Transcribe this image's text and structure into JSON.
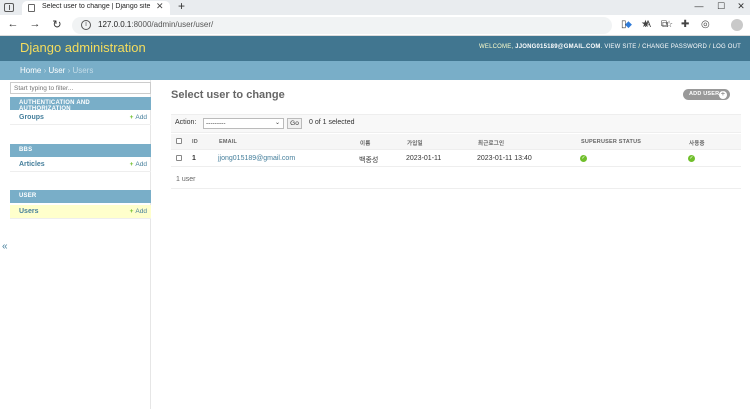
{
  "browser": {
    "tab_title": "Select user to change | Django site admin",
    "tab_close": "✕",
    "new_tab": "+",
    "url_host": "127.0.0.1",
    "url_path": ":8000/admin/user/user/",
    "win_min": "—",
    "win_max": "☐",
    "win_close": "✕"
  },
  "header": {
    "site_name": "Django administration",
    "welcome": "WELCOME,",
    "user_email": "JJONG015189@GMAIL.COM",
    "view_site": "VIEW SITE",
    "change_password": "CHANGE PASSWORD",
    "log_out": "LOG OUT",
    "separator": " / "
  },
  "breadcrumbs": {
    "home": "Home",
    "app": "User",
    "current": "Users",
    "separator": " › "
  },
  "sidebar": {
    "filter_placeholder": "Start typing to filter...",
    "add_label": "Add",
    "modules": [
      {
        "caption": "AUTHENTICATION AND AUTHORIZATION",
        "models": [
          "Groups"
        ]
      },
      {
        "caption": "BBS",
        "models": [
          "Articles"
        ]
      },
      {
        "caption": "USER",
        "models": [
          "Users"
        ]
      }
    ],
    "collapse_glyph": "«"
  },
  "content": {
    "title": "Select user to change",
    "add_button": "ADD USER",
    "action_label": "Action:",
    "action_selected": "---------",
    "go_label": "Go",
    "selection_count": "0 of 1 selected",
    "columns": [
      "ID",
      "EMAIL",
      "이름",
      "가입일",
      "최근로그인",
      "SUPERUSER STATUS",
      "사용중"
    ],
    "rows": [
      {
        "id": "1",
        "email": "jjong015189@gmail.com",
        "name": "백종성",
        "joined": "2023-01-11",
        "last_login": "2023-01-11 13:40",
        "superuser": true,
        "active": true
      }
    ],
    "paginator": "1 user"
  },
  "colors": {
    "header_bg": "#417690",
    "breadcrumb_bg": "#79aec8",
    "site_name": "#f5dd5d",
    "link": "#447e9b",
    "current_model_bg": "#ffffcc",
    "yes_icon": "#70bf2b"
  }
}
